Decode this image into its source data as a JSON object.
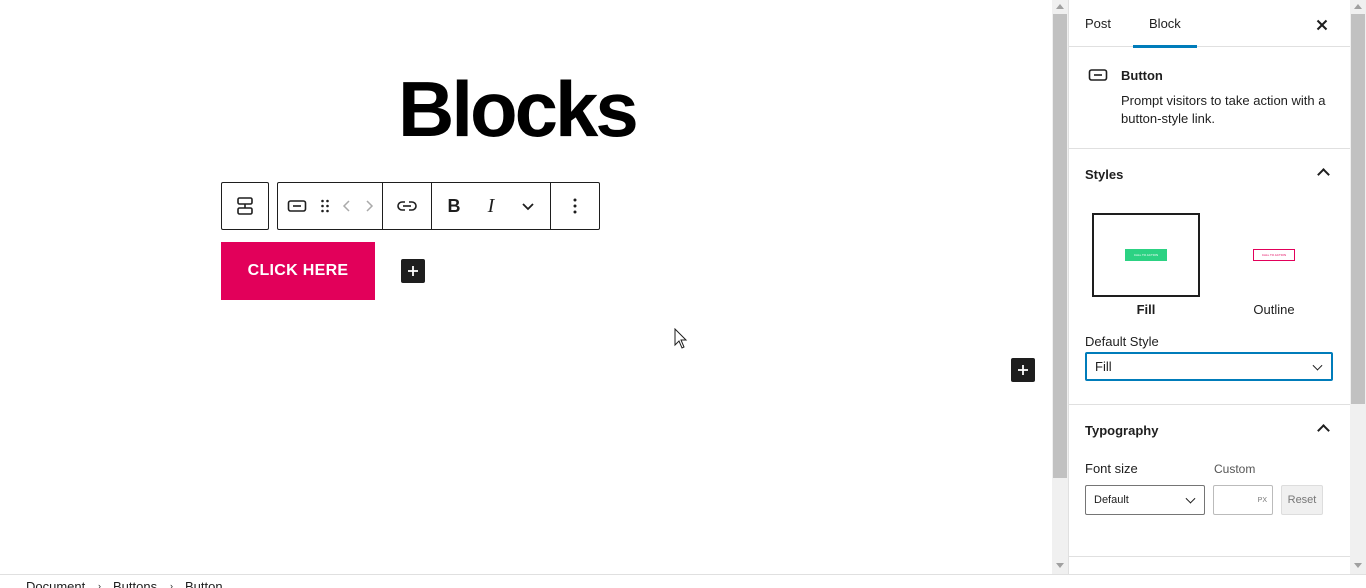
{
  "editor": {
    "page_title": "Blocks",
    "button_text": "CLICK HERE"
  },
  "toolbar": {
    "parent_icon": "group-icon",
    "icons": [
      "button-icon",
      "drag-handle-icon",
      "move-left-icon",
      "move-right-icon",
      "link-icon",
      "bold-icon",
      "italic-icon",
      "more-chevron-icon",
      "options-icon"
    ],
    "bold_label": "B",
    "italic_label": "I"
  },
  "sidebar": {
    "tabs": [
      {
        "label": "Post"
      },
      {
        "label": "Block"
      }
    ],
    "active_tab": "Block",
    "block_card": {
      "name": "Button",
      "description": "Prompt visitors to take action with a button-style link."
    },
    "styles": {
      "title": "Styles",
      "options": [
        {
          "label": "Fill",
          "preview_text": "CALL TO ACTION",
          "selected": true
        },
        {
          "label": "Outline",
          "preview_text": "CALL TO ACTION",
          "selected": false
        }
      ],
      "default_style_label": "Default Style",
      "default_style_value": "Fill"
    },
    "typography": {
      "title": "Typography",
      "font_size_label": "Font size",
      "custom_label": "Custom",
      "font_size_value": "Default",
      "custom_value": "",
      "unit": "PX",
      "reset_label": "Reset"
    }
  },
  "breadcrumb": [
    "Document",
    "Buttons",
    "Button"
  ],
  "colors": {
    "button_bg": "#e2005a",
    "accent": "#007cba",
    "fill_preview": "#2cd283",
    "outline_preview": "#e2005a"
  }
}
